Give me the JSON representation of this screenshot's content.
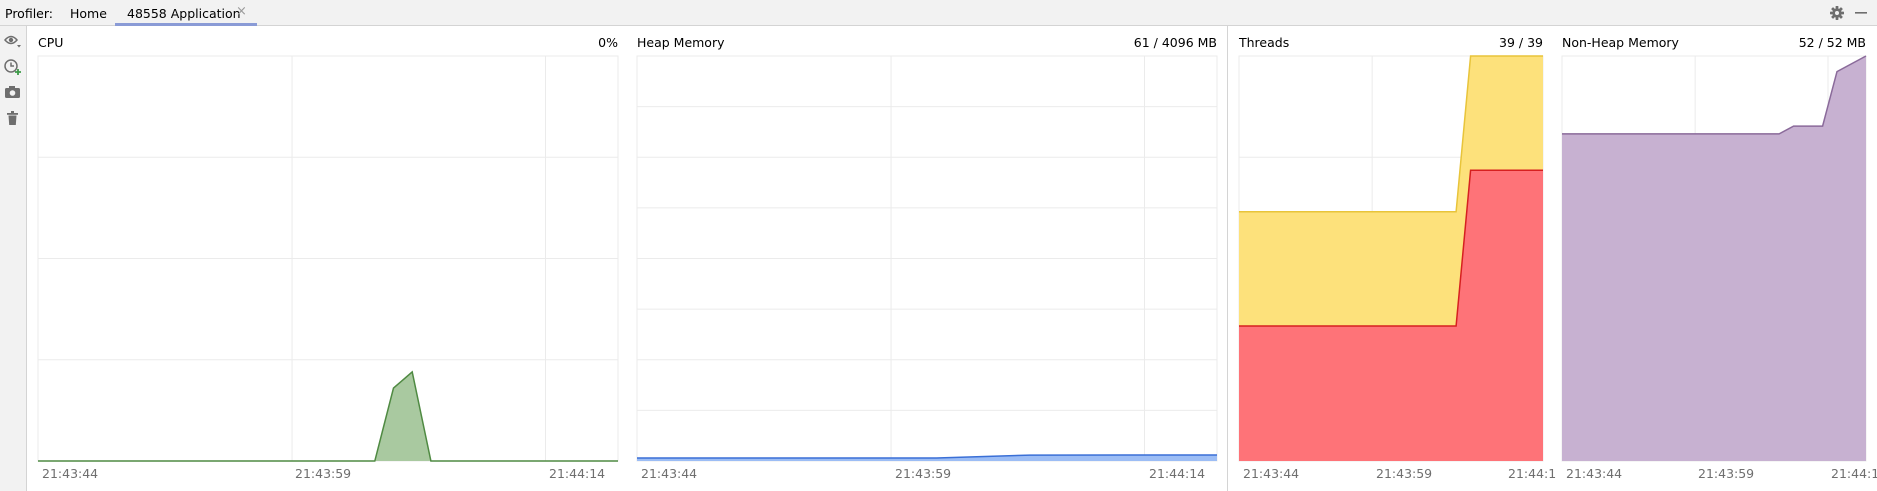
{
  "toolbar": {
    "profiler_label": "Profiler:",
    "tabs": [
      {
        "label": "Home",
        "active": false
      },
      {
        "label": "48558 Application",
        "active": true
      }
    ],
    "close_glyph": "×",
    "right_icons": [
      "gear-icon",
      "minimize-icon"
    ],
    "side_tools": [
      "eye-icon",
      "clock-add-icon",
      "camera-icon",
      "trash-icon"
    ]
  },
  "colors": {
    "cpu": "#a9c9a0",
    "cpu_line": "#4f8a42",
    "heap": "#9cbdf5",
    "heap_line": "#3a6fd6",
    "threads_total": "#fde17b",
    "threads_total_line": "#e8c43a",
    "threads_live": "#fe7378",
    "threads_live_line": "#d62020",
    "nonheap": "#c7b1d1",
    "nonheap_line": "#8a6a9a",
    "grid": "#ebebeb"
  },
  "chart_data": [
    {
      "type": "area",
      "title": "CPU",
      "current": "0%",
      "x": [
        "21:43:44",
        "21:43:45",
        "21:43:50",
        "21:43:55",
        "21:43:58",
        "21:44:00",
        "21:44:02",
        "21:44:03",
        "21:44:04",
        "21:44:05",
        "21:44:07",
        "21:44:10",
        "21:44:15"
      ],
      "y": [
        0,
        0,
        0,
        0,
        0,
        0,
        0,
        18,
        22,
        0,
        0,
        0,
        0
      ],
      "ylim": [
        0,
        100
      ],
      "tick_labels": [
        "21:43:44",
        "21:43:59",
        "21:44:14"
      ],
      "grid": true
    },
    {
      "type": "area",
      "title": "Heap Memory",
      "current": "61 / 4096 MB",
      "x": [
        "21:43:44",
        "21:43:50",
        "21:43:55",
        "21:44:00",
        "21:44:05",
        "21:44:10",
        "21:44:15"
      ],
      "y": [
        30,
        30,
        30,
        30,
        60,
        61,
        61
      ],
      "ylim": [
        0,
        4096
      ],
      "tick_labels": [
        "21:43:44",
        "21:43:59",
        "21:44:14"
      ],
      "grid": true
    },
    {
      "type": "area",
      "title": "Threads",
      "current": "39 / 39",
      "x": [
        "21:43:44",
        "21:43:50",
        "21:43:55",
        "21:43:59",
        "21:44:00",
        "21:44:05"
      ],
      "series": [
        {
          "values": [
            24,
            24,
            24,
            24,
            39,
            39
          ]
        },
        {
          "values": [
            13,
            13,
            13,
            13,
            28,
            28
          ]
        }
      ],
      "ylim": [
        0,
        39
      ],
      "tick_labels": [
        "21:43:44",
        "21:43:59",
        "21:44:1"
      ],
      "grid": true
    },
    {
      "type": "area",
      "title": "Non-Heap Memory",
      "current": "52 / 52 MB",
      "x": [
        "21:43:44",
        "21:43:50",
        "21:43:55",
        "21:43:59",
        "21:44:00",
        "21:44:02",
        "21:44:03",
        "21:44:05"
      ],
      "y": [
        42,
        42,
        42,
        42,
        43,
        43,
        50,
        52
      ],
      "ylim": [
        0,
        52
      ],
      "tick_labels": [
        "21:43:44",
        "21:43:59",
        "21:44:1"
      ],
      "grid": true
    }
  ]
}
